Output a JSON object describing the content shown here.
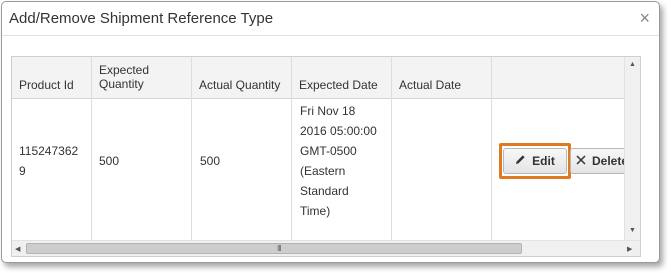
{
  "dialog": {
    "title": "Add/Remove Shipment Reference Type",
    "close_icon": "×"
  },
  "table": {
    "columns": [
      {
        "label1": "Product Id",
        "label2": ""
      },
      {
        "label1": "Expected",
        "label2": "Quantity"
      },
      {
        "label1": "Actual Quantity",
        "label2": ""
      },
      {
        "label1": "Expected Date",
        "label2": ""
      },
      {
        "label1": "Actual Date",
        "label2": ""
      }
    ],
    "row": {
      "product_id_line1": "115247362",
      "product_id_line2": "9",
      "expected_quantity": "500",
      "actual_quantity": "500",
      "expected_date_lines": [
        "Fri Nov 18",
        "2016 05:00:00",
        "GMT-0500",
        "(Eastern",
        "Standard",
        "Time)"
      ],
      "actual_date": ""
    }
  },
  "actions": {
    "edit_label": "Edit",
    "edit_icon": "pencil-icon",
    "delete_label": "Delete",
    "delete_icon": "x-icon"
  },
  "scrollbar": {
    "grip": "III"
  },
  "colors": {
    "highlight": "#e07a20"
  }
}
